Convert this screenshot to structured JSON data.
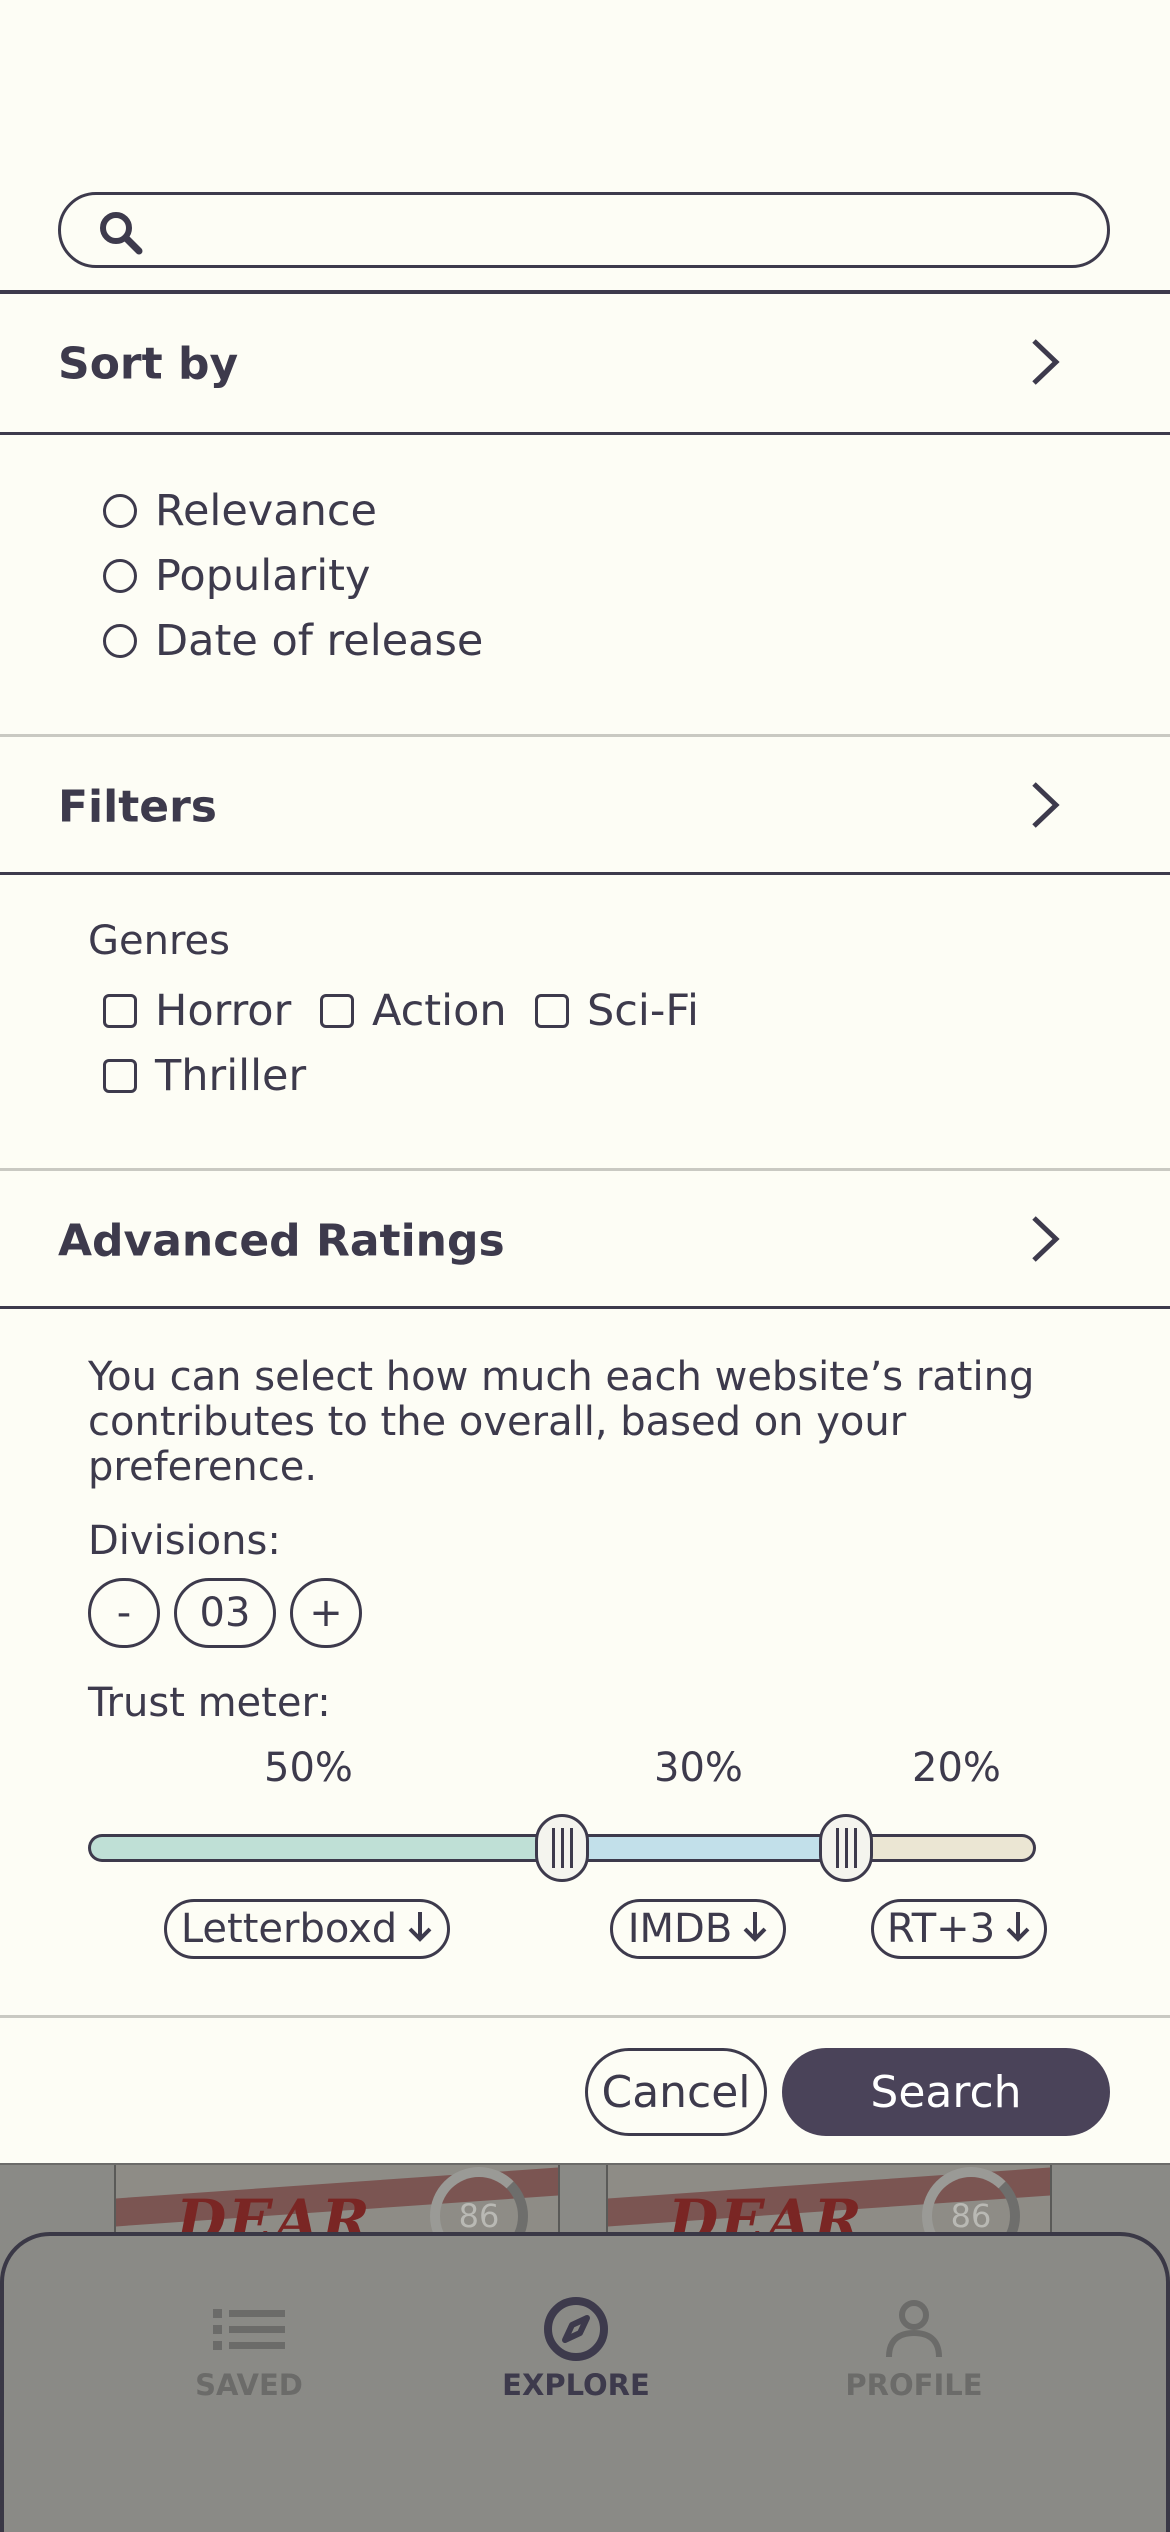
{
  "search": {
    "placeholder": "",
    "value": ""
  },
  "sort": {
    "header": "Sort by",
    "options": [
      "Relevance",
      "Popularity",
      "Date of release"
    ]
  },
  "filters": {
    "header": "Filters",
    "genres_label": "Genres",
    "genres": [
      "Horror",
      "Action",
      "Sci-Fi",
      "Thriller"
    ]
  },
  "advanced": {
    "header": "Advanced Ratings",
    "description": "You can select how much each website’s rating contributes to the overall, based on your preference.",
    "divisions_label": "Divisions:",
    "divisions_minus": "-",
    "divisions_value": "03",
    "divisions_plus": "+",
    "trust_label": "Trust meter:",
    "segments": [
      {
        "percent": "50%",
        "source": "Letterboxd",
        "share": 0.5,
        "color": "#bfe0d6"
      },
      {
        "percent": "30%",
        "source": "IMDB",
        "share": 0.3,
        "color": "#c2e0ea"
      },
      {
        "percent": "20%",
        "source": "RT+3",
        "share": 0.2,
        "color": "#ebe6d3"
      }
    ]
  },
  "actions": {
    "cancel": "Cancel",
    "search": "Search"
  },
  "background": {
    "posters": [
      {
        "title": "DEAR",
        "score": "86"
      },
      {
        "title": "DEAR",
        "score": "86"
      }
    ]
  },
  "tabbar": {
    "items": [
      {
        "label": "SAVED",
        "icon": "list-icon"
      },
      {
        "label": "EXPLORE",
        "icon": "compass-icon"
      },
      {
        "label": "PROFILE",
        "icon": "person-icon"
      }
    ],
    "active": "EXPLORE"
  },
  "colors": {
    "ink": "#3d3a4c",
    "sheet": "#fdfdf5",
    "primary_button": "#4a4359",
    "dim_overlay": "#8a8a86"
  }
}
